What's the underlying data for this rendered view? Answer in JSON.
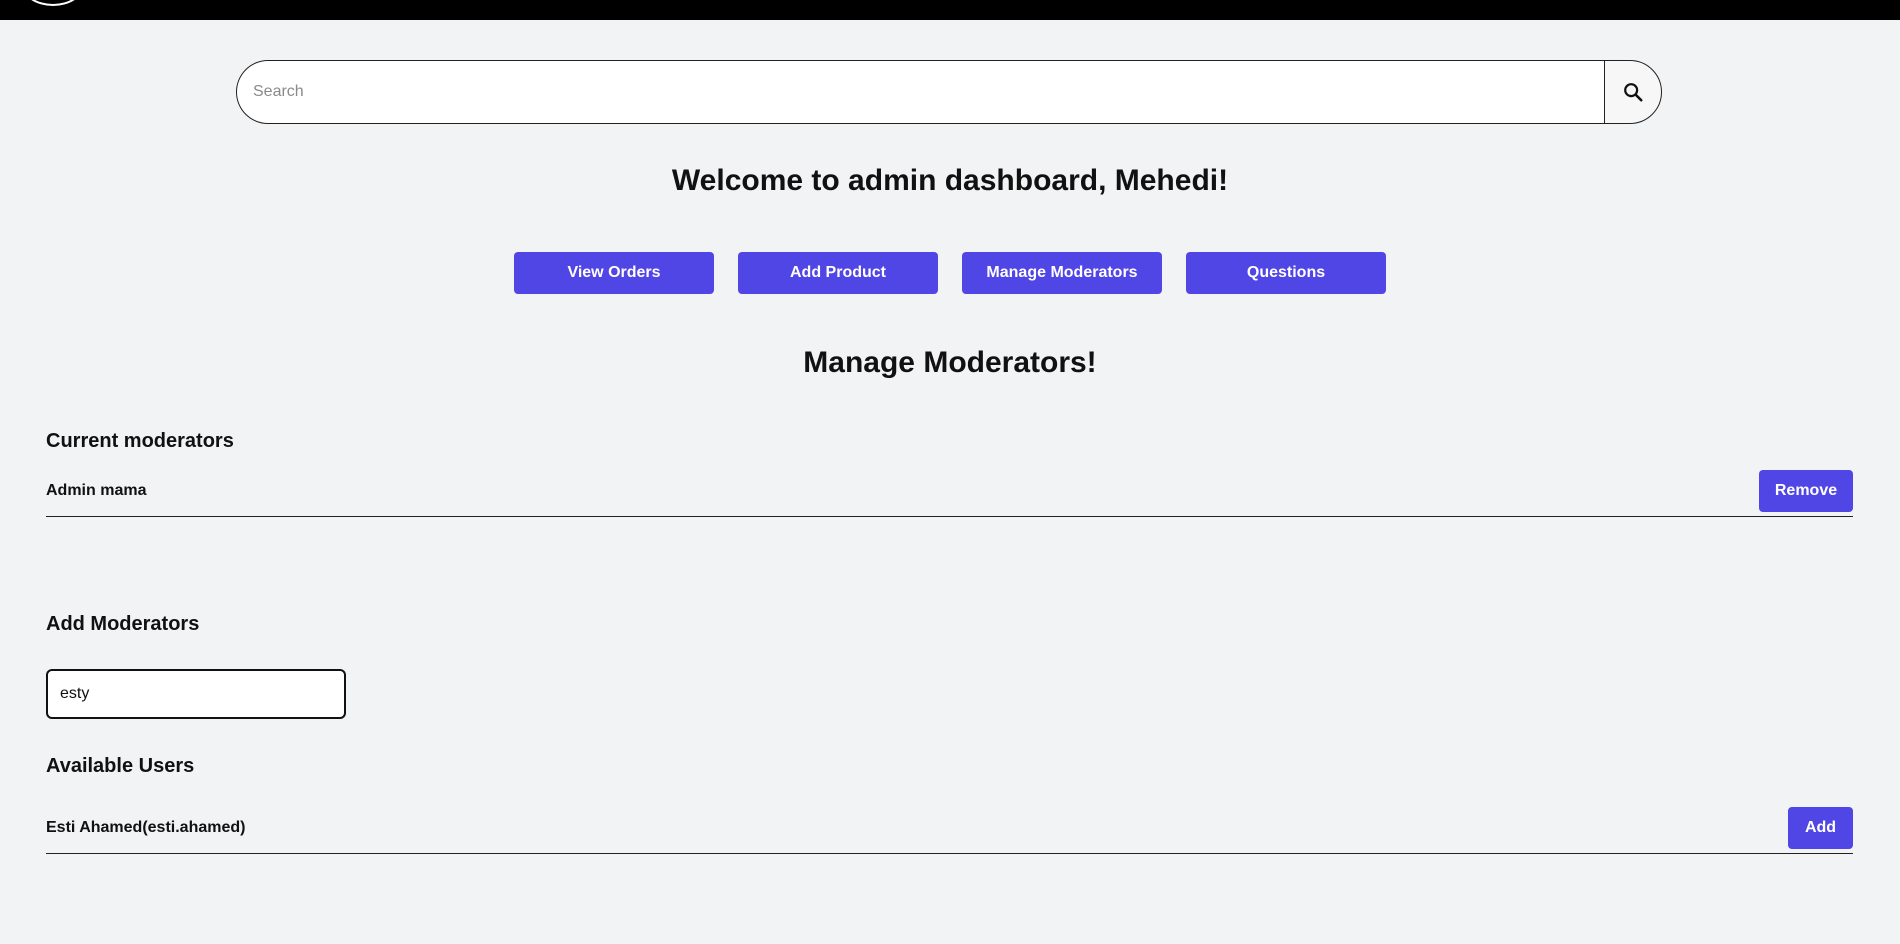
{
  "search": {
    "placeholder": "Search",
    "value": "",
    "button_icon": "search-icon"
  },
  "welcome_text": "Welcome to admin dashboard, Mehedi!",
  "nav_buttons": [
    {
      "label": "View Orders"
    },
    {
      "label": "Add Product"
    },
    {
      "label": "Manage Moderators"
    },
    {
      "label": "Questions"
    }
  ],
  "section_title": "Manage Moderators!",
  "current_moderators": {
    "heading": "Current moderators",
    "items": [
      {
        "name": "Admin mama",
        "action_label": "Remove"
      }
    ]
  },
  "add_moderators": {
    "heading": "Add Moderators",
    "input_value": "esty"
  },
  "available_users": {
    "heading": "Available Users",
    "items": [
      {
        "name": "Esti Ahamed(esti.ahamed)",
        "action_label": "Add"
      }
    ]
  },
  "colors": {
    "accent": "#4f46e5",
    "background": "#f2f3f5",
    "topbar": "#000000"
  }
}
